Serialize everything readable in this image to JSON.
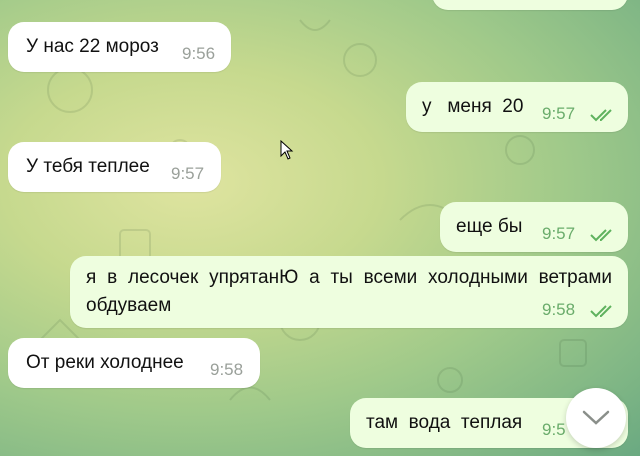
{
  "messages": [
    {
      "text": "У нас 22 мороз",
      "time": "9:56"
    },
    {
      "text": "у   меня  20",
      "time": "9:57"
    },
    {
      "text": "У тебя теплее",
      "time": "9:57"
    },
    {
      "text": "еще бы",
      "time": "9:57"
    },
    {
      "text": "я  в  лесочек упрятанЮ а ты  всеми холодными  ветрами обдуваем",
      "time": "9:58"
    },
    {
      "text": "От реки холоднее",
      "time": "9:58"
    },
    {
      "text": "там  вода  теплая",
      "time": "9:5"
    }
  ],
  "colors": {
    "incoming_bubble": "#ffffff",
    "outgoing_bubble": "#eefedf",
    "read_check": "#5fb25e"
  },
  "icons": {
    "read_status": "double-check-icon",
    "scroll_down": "chevron-down-icon",
    "pointer": "mouse-cursor-icon"
  }
}
